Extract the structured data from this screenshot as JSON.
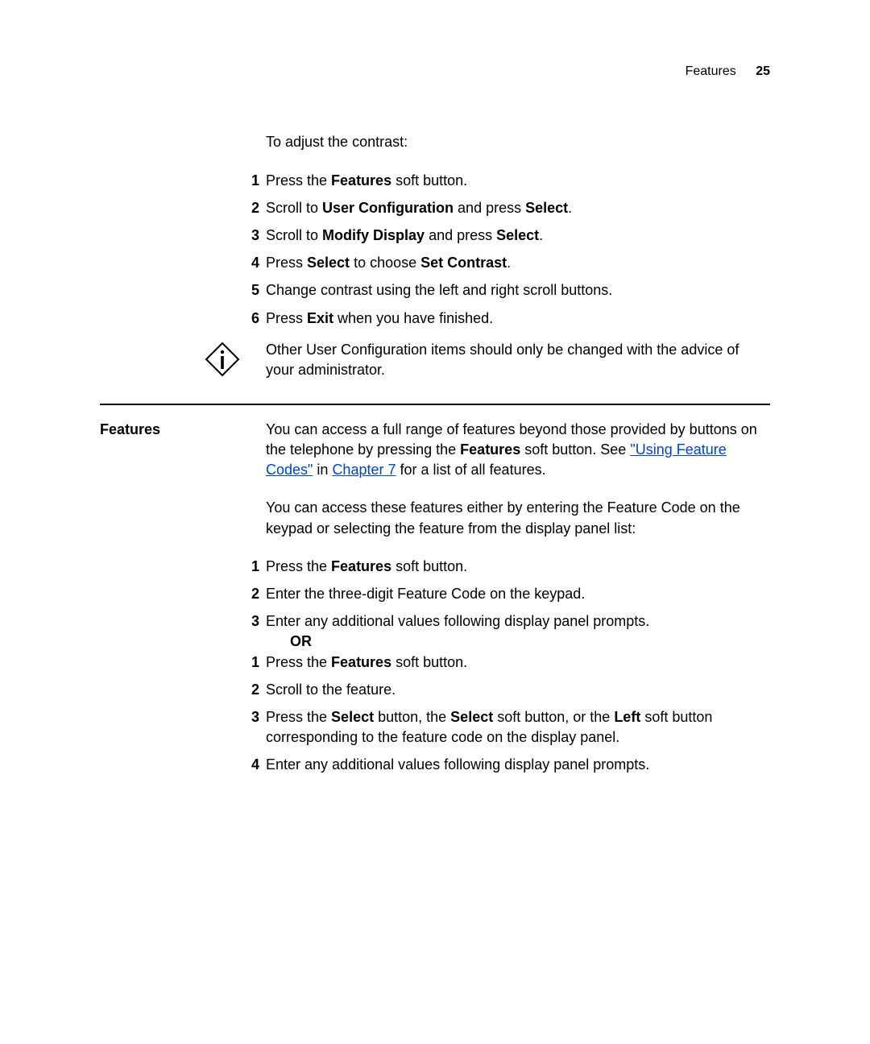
{
  "header": {
    "section": "Features",
    "page": "25"
  },
  "block1": {
    "intro": "To adjust the contrast:",
    "steps": {
      "s1a": "Press the ",
      "s1b": "Features",
      "s1c": " soft button.",
      "s2a": "Scroll to ",
      "s2b": "User Configuration",
      "s2c": " and press ",
      "s2d": "Select",
      "s2e": ".",
      "s3a": "Scroll to ",
      "s3b": "Modify Display",
      "s3c": " and press ",
      "s3d": "Select",
      "s3e": ".",
      "s4a": "Press ",
      "s4b": "Select",
      "s4c": " to choose ",
      "s4d": "Set Contrast",
      "s4e": ".",
      "s5": "Change contrast using the left and right scroll buttons.",
      "s6a": "Press ",
      "s6b": "Exit",
      "s6c": " when you have finished."
    },
    "info": {
      "a": "Other ",
      "b": "User Configuration",
      "c": " items should only be changed with the advice of your administrator."
    }
  },
  "block2": {
    "heading": "Features",
    "p1": {
      "a": "You can access a full range of features beyond those provided by buttons on the telephone by pressing the ",
      "b": "Features",
      "c": " soft button. See ",
      "link1": "\"Using Feature Codes\"",
      "d": " in ",
      "link2": "Chapter 7",
      "e": " for a list of all features."
    },
    "p2": "You can access these features either by entering the Feature Code on the keypad or selecting the feature from the display panel list:",
    "listA": {
      "s1a": "Press the ",
      "s1b": "Features",
      "s1c": " soft button.",
      "s2": "Enter the three-digit Feature Code on the keypad.",
      "s3": "Enter any additional values following display panel prompts."
    },
    "or": "OR",
    "listB": {
      "s1a": "Press the ",
      "s1b": "Features",
      "s1c": " soft button.",
      "s2": "Scroll to the feature.",
      "s3a": "Press the ",
      "s3b": "Select",
      "s3c": " button, the ",
      "s3d": "Select",
      "s3e": " soft button, or the ",
      "s3f": "Left",
      "s3g": " soft button corresponding to the feature code on the display panel.",
      "s4": "Enter any additional values following display panel prompts."
    }
  }
}
